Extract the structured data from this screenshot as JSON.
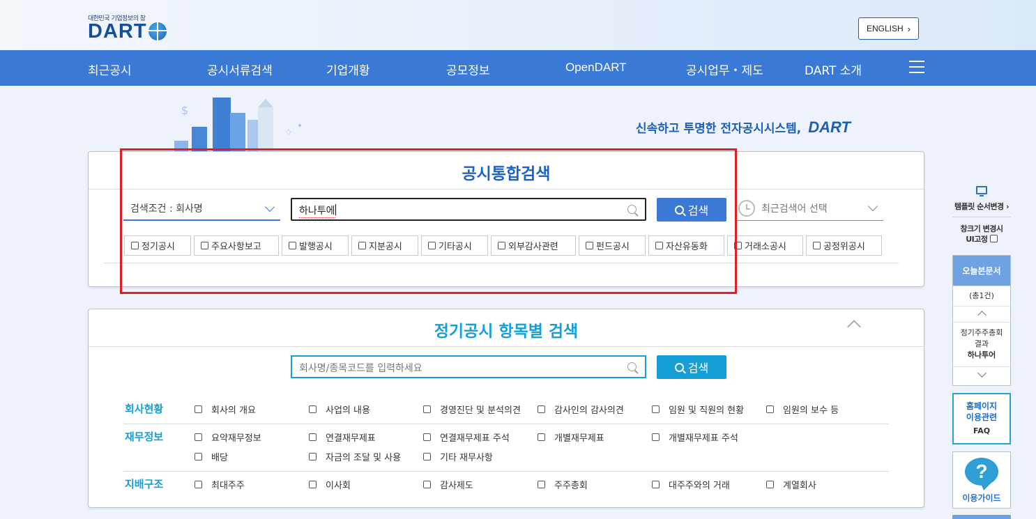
{
  "header": {
    "logo_tagline": "대한민국 기업정보의 창",
    "logo_word": "DART",
    "english_button": "ENGLISH"
  },
  "nav": {
    "items": [
      "최근공시",
      "공시서류검색",
      "기업개황",
      "공모정보",
      "OpenDART",
      "공시업무・제도",
      "DART 소개"
    ]
  },
  "hero": {
    "slogan": "신속하고 투명한 전자공시시스템,",
    "slogan_brand": "DART"
  },
  "integrated_search": {
    "title": "공시통합검색",
    "condition_select": "검색조건 : 회사명",
    "query_value": "하나투에",
    "search_button": "검색",
    "recent_select_placeholder": "최근검색어 선택",
    "filters": [
      "정기공시",
      "주요사항보고",
      "발행공시",
      "지분공시",
      "기타공시",
      "외부감사관련",
      "펀드공시",
      "자산유동화",
      "거래소공시",
      "공정위공시"
    ]
  },
  "periodic_search": {
    "title": "정기공시 항목별 검색",
    "input_placeholder": "회사명/종목코드를 입력하세요",
    "search_button": "검색",
    "categories": [
      {
        "name": "회사현황",
        "options": [
          "회사의 개요",
          "사업의 내용",
          "경영진단 및 분석의견",
          "감사인의 감사의견",
          "임원 및 직원의 현황",
          "임원의 보수 등"
        ]
      },
      {
        "name": "재무정보",
        "options": [
          "요약재무정보",
          "연결재무제표",
          "연결재무제표 주석",
          "개별재무제표",
          "개별재무제표 주석",
          "배당",
          "자금의 조달 및 사용",
          "기타 재무사항"
        ]
      },
      {
        "name": "지배구조",
        "options": [
          "최대주주",
          "이사회",
          "감사제도",
          "주주총회",
          "대주주와의 거래",
          "계열회사"
        ]
      }
    ]
  },
  "quick_bar": {
    "template_order": "템플릿 순서변경",
    "window_fix_line1": "창크기 변경시",
    "window_fix_line2": "UI고정",
    "today_docs": "오늘본문서",
    "today_count": "(총1건)",
    "today_item_line1": "정기주주총회",
    "today_item_line2": "결과",
    "today_item_company": "하나투어",
    "faq_line1": "홈페이지",
    "faq_line2": "이용관련",
    "faq_label": "FAQ",
    "guide_label": "이용가이드"
  },
  "colors": {
    "nav_bg": "#3a7ad6",
    "search_button": "#3a7ad6",
    "periodic_accent": "#14a0d7",
    "highlight_box": "#e01e26"
  }
}
